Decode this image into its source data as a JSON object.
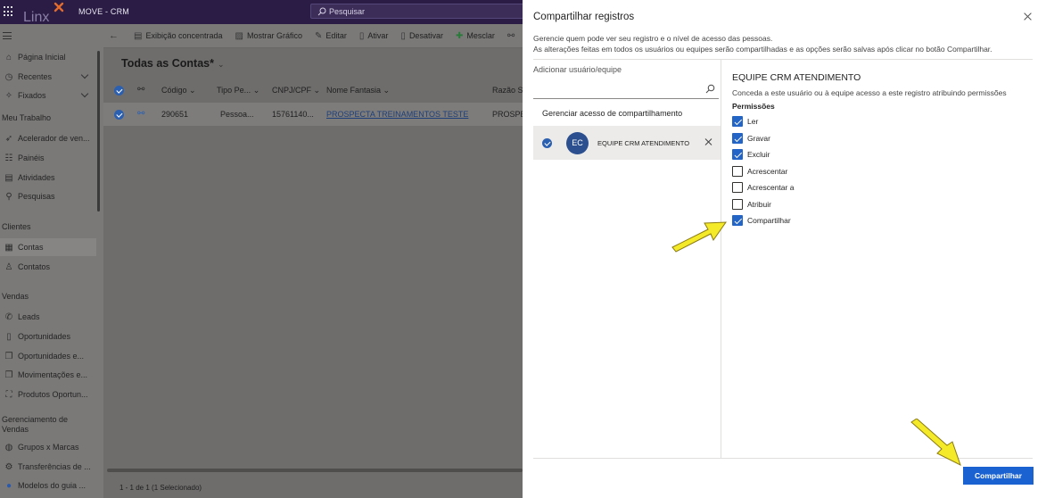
{
  "app": {
    "title": "MOVE - CRM",
    "logo_text": "Linx"
  },
  "search": {
    "placeholder": "Pesquisar"
  },
  "sidebar": {
    "items": [
      {
        "label": "Página Inicial",
        "icon": "home-icon"
      },
      {
        "label": "Recentes",
        "icon": "clock-icon"
      },
      {
        "label": "Fixados",
        "icon": "pin-icon"
      }
    ],
    "sections": [
      {
        "title": "Meu Trabalho",
        "items": [
          {
            "label": "Acelerador de ven..."
          },
          {
            "label": "Painéis"
          },
          {
            "label": "Atividades"
          },
          {
            "label": "Pesquisas"
          }
        ]
      },
      {
        "title": "Clientes",
        "items": [
          {
            "label": "Contas"
          },
          {
            "label": "Contatos"
          }
        ]
      },
      {
        "title": "Vendas",
        "items": [
          {
            "label": "Leads"
          },
          {
            "label": "Oportunidades"
          },
          {
            "label": "Oportunidades e..."
          },
          {
            "label": "Movimentações e..."
          },
          {
            "label": "Produtos Oportun..."
          }
        ]
      },
      {
        "title": "Gerenciamento de Vendas",
        "items": [
          {
            "label": "Grupos x Marcas"
          },
          {
            "label": "Transferências de ..."
          },
          {
            "label": "Modelos do guia ..."
          }
        ]
      }
    ]
  },
  "commandbar": {
    "items": [
      "Exibição concentrada",
      "Mostrar Gráfico",
      "Editar",
      "Ativar",
      "Desativar",
      "Mesclar"
    ]
  },
  "view": {
    "title": "Todas as Contas*"
  },
  "grid": {
    "columns": [
      "Código",
      "Tipo Pe...",
      "CNPJ/CPF",
      "Nome Fantasia",
      "Razão S..."
    ],
    "rows": [
      {
        "codigo": "290651",
        "tipo": "Pessoa...",
        "cnpj": "15761140...",
        "nome": "PROSPECTA TREINAMENTOS TESTE",
        "razao": "PROSPEC"
      }
    ],
    "footer": "1 - 1 de 1 (1 Selecionado)"
  },
  "panel": {
    "title": "Compartilhar registros",
    "desc_line1": "Gerencie quem pode ver seu registro e o nível de acesso das pessoas.",
    "desc_line2": "As alterações feitas em todos os usuários ou equipes serão compartilhadas e as opções serão salvas após clicar no botão Compartilhar.",
    "add_label": "Adicionar usuário/equipe",
    "manage_label": "Gerenciar acesso de compartilhamento",
    "team": {
      "initials": "EC",
      "name": "EQUIPE CRM ATENDIMENTO"
    },
    "perm_team": "EQUIPE CRM ATENDIMENTO",
    "perm_desc": "Conceda a este usuário ou à equipe acesso a este registro atribuindo permissões",
    "perm_title": "Permissões",
    "permissions": [
      {
        "label": "Ler",
        "checked": true
      },
      {
        "label": "Gravar",
        "checked": true
      },
      {
        "label": "Excluir",
        "checked": true
      },
      {
        "label": "Acrescentar",
        "checked": false
      },
      {
        "label": "Acrescentar a",
        "checked": false
      },
      {
        "label": "Atribuir",
        "checked": false
      },
      {
        "label": "Compartilhar",
        "checked": true
      }
    ],
    "share_button": "Compartilhar"
  },
  "colors": {
    "accent": "#1a62d2",
    "topbar": "#2a1c45",
    "arrow": "#f4ea2a"
  }
}
